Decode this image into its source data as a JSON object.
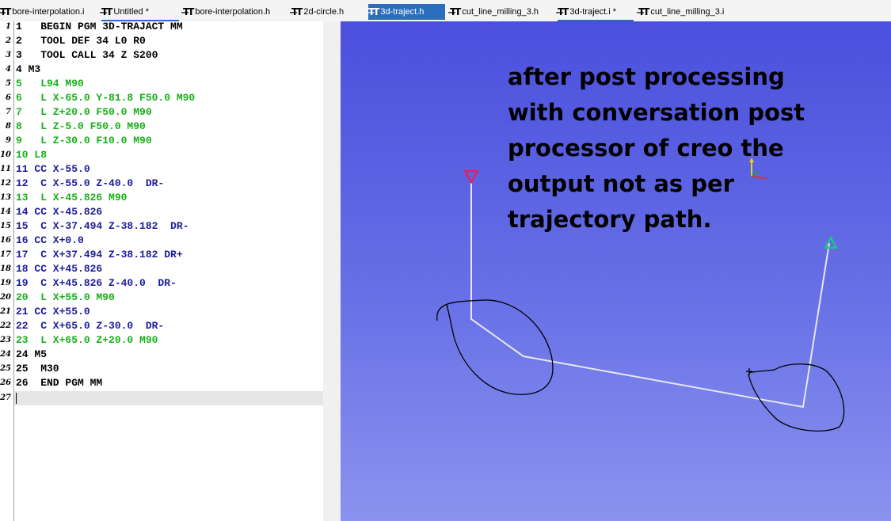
{
  "tabs": [
    {
      "label": "bore-interpolation.i",
      "icon": "cnc-file-icon"
    },
    {
      "label": "Untitled *",
      "icon": "cnc-file-icon"
    },
    {
      "label": "bore-interpolation.h",
      "icon": "cnc-file-icon"
    },
    {
      "label": "2d-circle.h",
      "icon": "cnc-file-icon"
    },
    {
      "label": "3d-traject.h",
      "icon": "cnc-file-icon",
      "active": true
    },
    {
      "label": "cut_line_milling_3.h",
      "icon": "cnc-file-icon"
    },
    {
      "label": "3d-traject.i *",
      "icon": "cnc-file-icon"
    },
    {
      "label": "cut_line_milling_3.i",
      "icon": "cnc-file-icon"
    }
  ],
  "editor": {
    "lines": [
      {
        "num": "1",
        "text": "1   BEGIN PGM 3D-TRAJACT MM",
        "color": "black"
      },
      {
        "num": "2",
        "text": "2   TOOL DEF 34 L0 R0",
        "color": "black"
      },
      {
        "num": "3",
        "text": "3   TOOL CALL 34 Z S200",
        "color": "black"
      },
      {
        "num": "4",
        "text": "4 M3",
        "color": "black"
      },
      {
        "num": "5",
        "text": "5   L94 M90",
        "color": "green"
      },
      {
        "num": "6",
        "text": "6   L X-65.0 Y-81.8 F50.0 M90",
        "color": "green"
      },
      {
        "num": "7",
        "text": "7   L Z+20.0 F50.0 M90",
        "color": "green"
      },
      {
        "num": "8",
        "text": "8   L Z-5.0 F50.0 M90",
        "color": "green"
      },
      {
        "num": "9",
        "text": "9   L Z-30.0 F10.0 M90",
        "color": "green"
      },
      {
        "num": "10",
        "text": "10 L8",
        "color": "green"
      },
      {
        "num": "11",
        "text": "11 CC X-55.0",
        "color": "blue"
      },
      {
        "num": "12",
        "text": "12  C X-55.0 Z-40.0  DR-",
        "color": "blue"
      },
      {
        "num": "13",
        "text": "13  L X-45.826 M90",
        "color": "green"
      },
      {
        "num": "14",
        "text": "14 CC X-45.826",
        "color": "blue"
      },
      {
        "num": "15",
        "text": "15  C X-37.494 Z-38.182  DR-",
        "color": "blue"
      },
      {
        "num": "16",
        "text": "16 CC X+0.0",
        "color": "blue"
      },
      {
        "num": "17",
        "text": "17  C X+37.494 Z-38.182 DR+",
        "color": "blue"
      },
      {
        "num": "18",
        "text": "18 CC X+45.826",
        "color": "blue"
      },
      {
        "num": "19",
        "text": "19  C X+45.826 Z-40.0  DR-",
        "color": "blue"
      },
      {
        "num": "20",
        "text": "20  L X+55.0 M90",
        "color": "green"
      },
      {
        "num": "21",
        "text": "21 CC X+55.0",
        "color": "blue"
      },
      {
        "num": "22",
        "text": "22  C X+65.0 Z-30.0  DR-",
        "color": "blue"
      },
      {
        "num": "23",
        "text": "23  L X+65.0 Z+20.0 M90",
        "color": "green"
      },
      {
        "num": "24",
        "text": "24 M5",
        "color": "black"
      },
      {
        "num": "25",
        "text": "25  M30",
        "color": "black"
      },
      {
        "num": "26",
        "text": "26  END PGM MM",
        "color": "black"
      },
      {
        "num": "27",
        "text": "",
        "color": "black",
        "current": true
      }
    ]
  },
  "viewport": {
    "annotation_lines": [
      "after post processing",
      "with conversation post",
      "processor of creo the",
      "output not as per",
      "trajectory path."
    ],
    "colors": {
      "start_marker": "#e0206a",
      "end_marker": "#22c08a",
      "path": "#e6e6ee",
      "scribble": "#000000"
    }
  },
  "colors": {
    "tab_active": "#2b6dbe",
    "code_green": "#16b016",
    "code_blue": "#1b1b9a"
  }
}
